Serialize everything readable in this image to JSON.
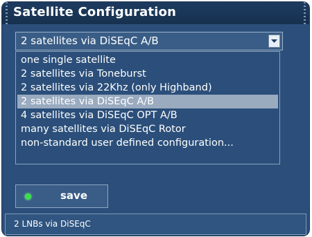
{
  "window": {
    "title": "Satellite Configuration"
  },
  "combo": {
    "selected_value": "2 satellites via DiSEqC A/B",
    "button_icon": "chevron-down-icon"
  },
  "list": {
    "items": [
      "one single satellite",
      "2 satellites via Toneburst",
      "2 satellites via 22Khz (only Highband)",
      "2 satellites via DiSEqC A/B",
      "4 satellites via DiSEqC OPT A/B",
      "many satellites via DiSEqC Rotor",
      "non-standard user defined configuration..."
    ],
    "selected_index": 3
  },
  "save": {
    "label": "save",
    "indicator_color": "#38e34a"
  },
  "status": {
    "text": "2 LNBs via DiSEqC"
  },
  "colors": {
    "panel": "#2b4f7a",
    "titlebar": "#16314f",
    "selected_row": "#9aabc0"
  }
}
